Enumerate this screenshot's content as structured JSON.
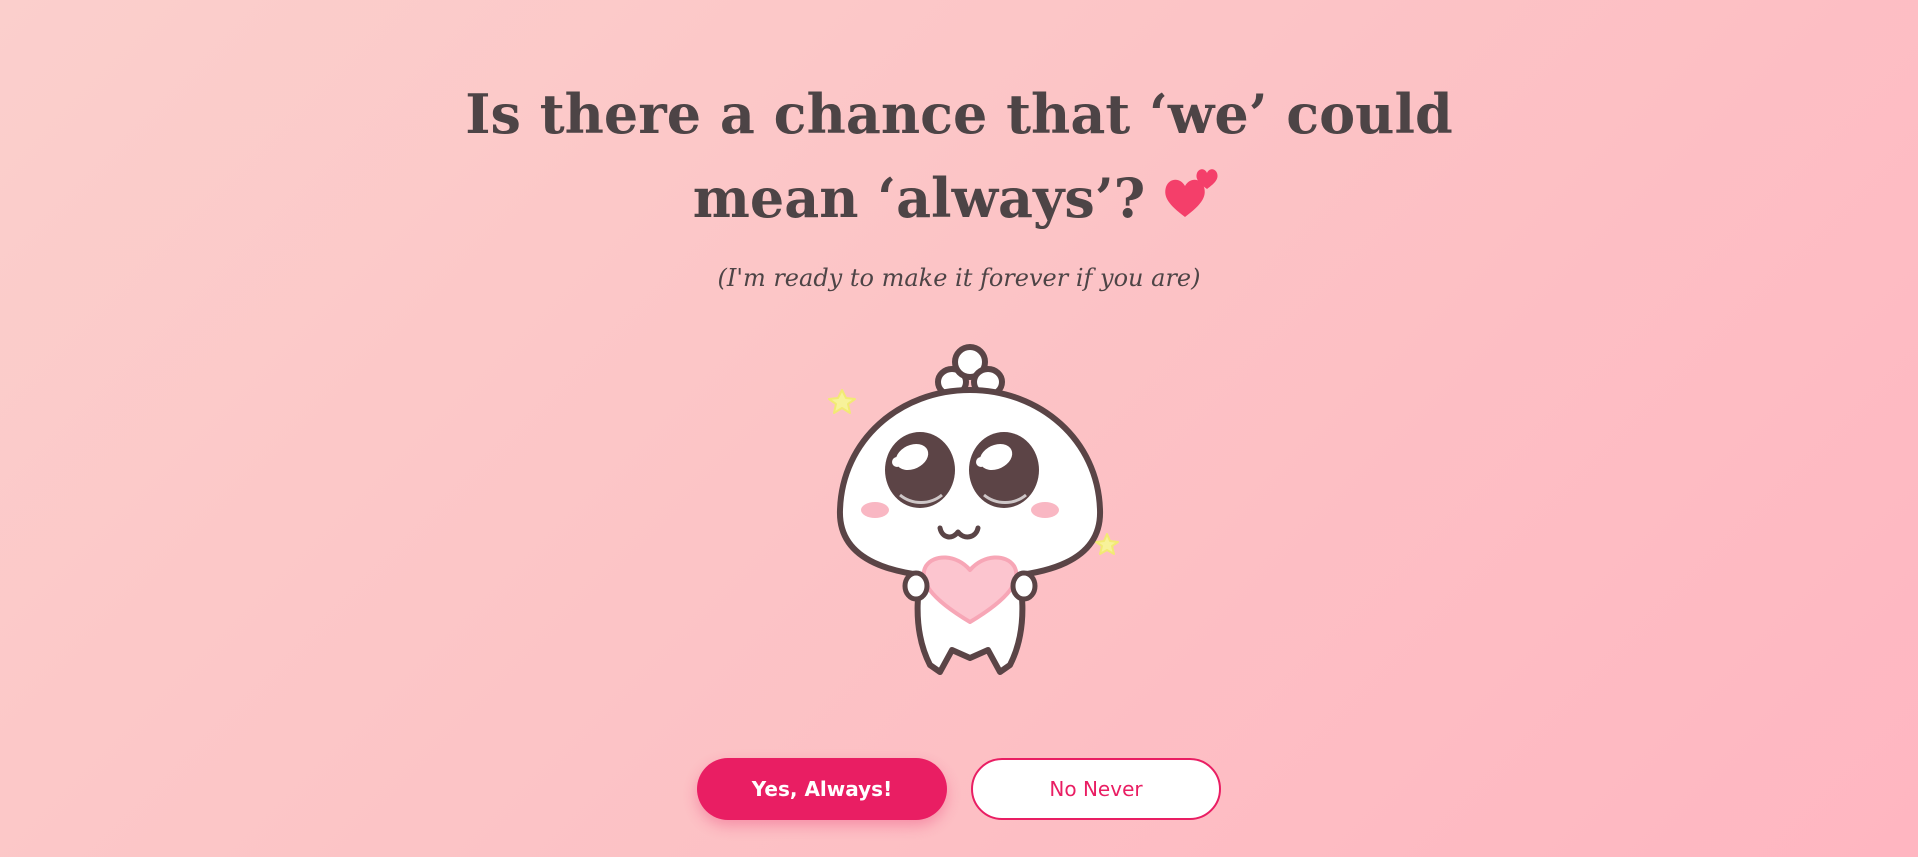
{
  "question": {
    "line1": "Is there a chance that ‘we’ could",
    "line2": "mean ‘always’?",
    "emoji": "two-hearts-icon"
  },
  "subtitle": "(I'm ready to make it forever if you are)",
  "mascot": {
    "name": "cute-mascot-holding-heart-illustration"
  },
  "buttons": {
    "yes_label": "Yes, Always!",
    "no_label": "No Never"
  },
  "colors": {
    "accent": "#e91e63",
    "heading": "#4d4446",
    "background_start": "#fbcfcc",
    "background_end": "#ffb6c1"
  }
}
